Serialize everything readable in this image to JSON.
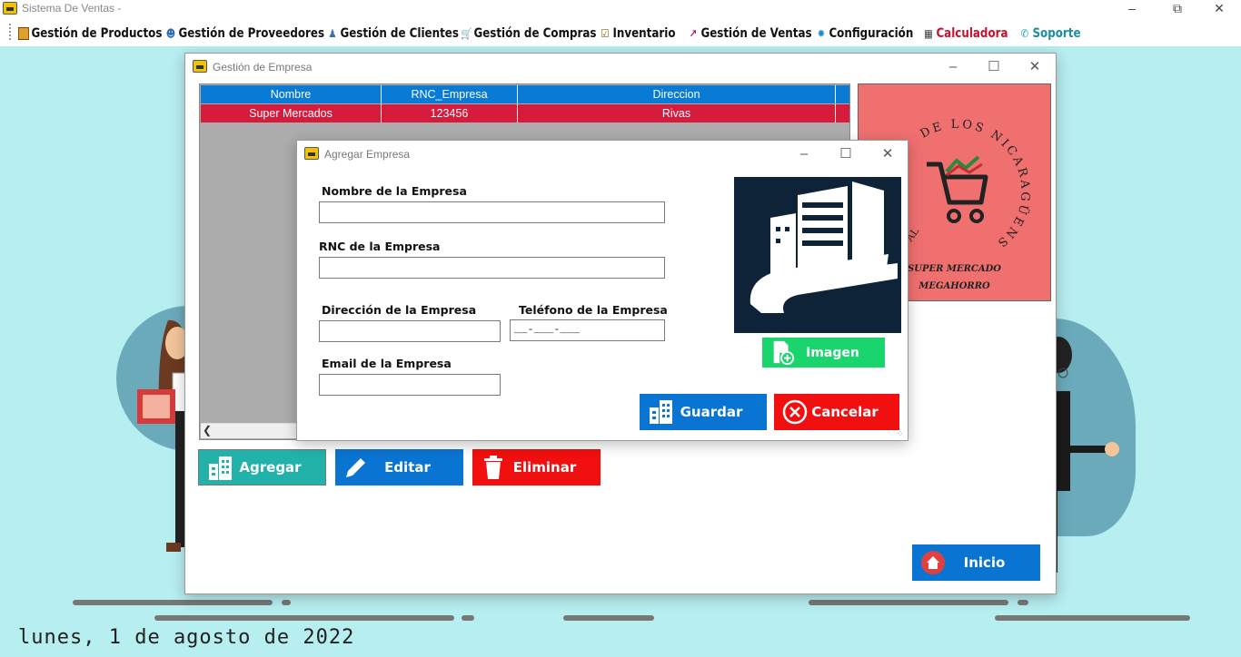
{
  "app": {
    "title": "Sistema De Ventas -"
  },
  "menu": {
    "items": [
      {
        "label": "Gestión de Productos",
        "icon": "product-icon"
      },
      {
        "label": "Gestión de Proveedores",
        "icon": "supplier-icon"
      },
      {
        "label": "Gestión de Clientes",
        "icon": "client-icon"
      },
      {
        "label": "Gestión de Compras",
        "icon": "cart-icon"
      },
      {
        "label": "Inventario",
        "icon": "inventory-icon"
      },
      {
        "label": "Gestión de Ventas",
        "icon": "sales-chart-icon"
      },
      {
        "label": "Configuración",
        "icon": "gear-icon"
      },
      {
        "label": "Calculadora",
        "icon": "calculator-icon"
      },
      {
        "label": "Soporte",
        "icon": "phone-icon"
      }
    ]
  },
  "empresa_window": {
    "title": "Gestión de Empresa",
    "table": {
      "columns": [
        "Nombre",
        "RNC_Empresa",
        "Direccion"
      ],
      "rows": [
        {
          "nombre": "Super Mercados",
          "rnc": "123456",
          "direccion": "Rivas"
        }
      ]
    },
    "logo": {
      "arc_text": "DE LOS NICARAGÜENSES",
      "side_text": "\"AL",
      "line1": "SUPER MERCADO",
      "line2": "MEGAHORRO"
    },
    "buttons": {
      "agregar": "Agregar",
      "editar": "Editar",
      "eliminar": "Eliminar",
      "inicio": "Inicio"
    }
  },
  "dialog": {
    "title": "Agregar Empresa",
    "fields": {
      "nombre_label": "Nombre de la Empresa",
      "nombre_value": "",
      "rnc_label": "RNC de la Empresa",
      "rnc_value": "",
      "direccion_label": "Dirección de la Empresa",
      "direccion_value": "",
      "telefono_label": "Teléfono de la Empresa",
      "telefono_mask": "__-___-___",
      "email_label": "Email de la Empresa",
      "email_value": ""
    },
    "buttons": {
      "imagen": "Imagen",
      "guardar": "Guardar",
      "cancelar": "Cancelar"
    }
  },
  "footer": {
    "date": "lunes, 1 de agosto de 2022"
  },
  "colors": {
    "background": "#b7eef0",
    "grid_header": "#0a7bd4",
    "grid_selected_row": "#d71b3c",
    "btn_teal": "#22b2aa",
    "btn_blue": "#0a74d2",
    "btn_red": "#f20f0f",
    "btn_green": "#1ad46e",
    "logo_bg": "#f07070",
    "building_bg": "#0f2338"
  }
}
